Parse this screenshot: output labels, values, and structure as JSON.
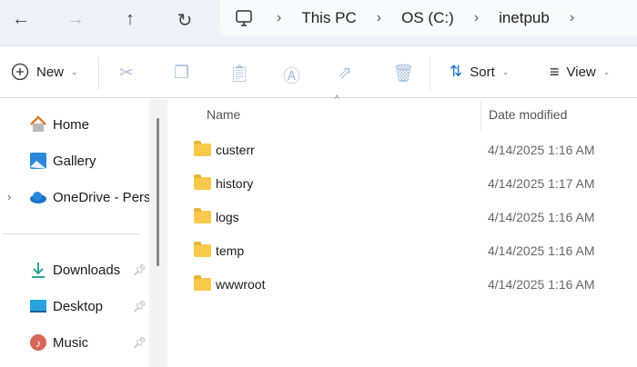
{
  "nav": {
    "back": "←",
    "forward": "→",
    "up": "↑",
    "refresh": "↻"
  },
  "breadcrumb": [
    "This PC",
    "OS (C:)",
    "inetpub"
  ],
  "toolbar": {
    "new_label": "New",
    "sort_label": "Sort",
    "view_label": "View"
  },
  "sidebar": {
    "items": [
      {
        "label": "Home"
      },
      {
        "label": "Gallery"
      },
      {
        "label": "OneDrive - Personal"
      },
      {
        "label": "Downloads"
      },
      {
        "label": "Desktop"
      },
      {
        "label": "Music"
      }
    ]
  },
  "columns": {
    "name": "Name",
    "date": "Date modified"
  },
  "files": [
    {
      "name": "custerr",
      "date": "4/14/2025 1:16 AM"
    },
    {
      "name": "history",
      "date": "4/14/2025 1:17 AM"
    },
    {
      "name": "logs",
      "date": "4/14/2025 1:16 AM"
    },
    {
      "name": "temp",
      "date": "4/14/2025 1:16 AM"
    },
    {
      "name": "wwwroot",
      "date": "4/14/2025 1:16 AM"
    }
  ]
}
